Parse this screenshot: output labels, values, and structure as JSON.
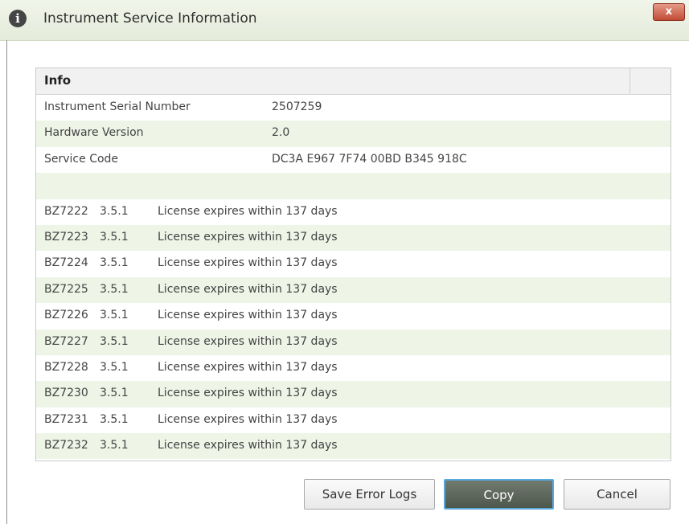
{
  "window": {
    "title": "Instrument Service Information",
    "icon": "info-icon",
    "close_label": "x"
  },
  "info": {
    "header": "Info",
    "fields": [
      {
        "label": "Instrument Serial Number",
        "value": "2507259"
      },
      {
        "label": "Hardware Version",
        "value": "2.0"
      },
      {
        "label": "Service Code",
        "value": "DC3A E967 7F74 00BD B345 918C"
      }
    ],
    "blank_row": "",
    "licenses": [
      {
        "module": "BZ7222",
        "version": "3.5.1",
        "status": "License expires within 137 days"
      },
      {
        "module": "BZ7223",
        "version": "3.5.1",
        "status": "License expires within 137 days"
      },
      {
        "module": "BZ7224",
        "version": "3.5.1",
        "status": "License expires within 137 days"
      },
      {
        "module": "BZ7225",
        "version": "3.5.1",
        "status": "License expires within 137 days"
      },
      {
        "module": "BZ7226",
        "version": "3.5.1",
        "status": "License expires within 137 days"
      },
      {
        "module": "BZ7227",
        "version": "3.5.1",
        "status": "License expires within 137 days"
      },
      {
        "module": "BZ7228",
        "version": "3.5.1",
        "status": "License expires within 137 days"
      },
      {
        "module": "BZ7230",
        "version": "3.5.1",
        "status": "License expires within 137 days"
      },
      {
        "module": "BZ7231",
        "version": "3.5.1",
        "status": "License expires within 137 days"
      },
      {
        "module": "BZ7232",
        "version": "3.5.1",
        "status": "License expires within 137 days"
      }
    ]
  },
  "buttons": {
    "save_error_logs": "Save Error Logs",
    "copy": "Copy",
    "cancel": "Cancel"
  },
  "colors": {
    "alt_row": "#eef4e6",
    "close_button": "#c24b35",
    "copy_button": "#5f685c",
    "focus_border": "#58a9de"
  }
}
